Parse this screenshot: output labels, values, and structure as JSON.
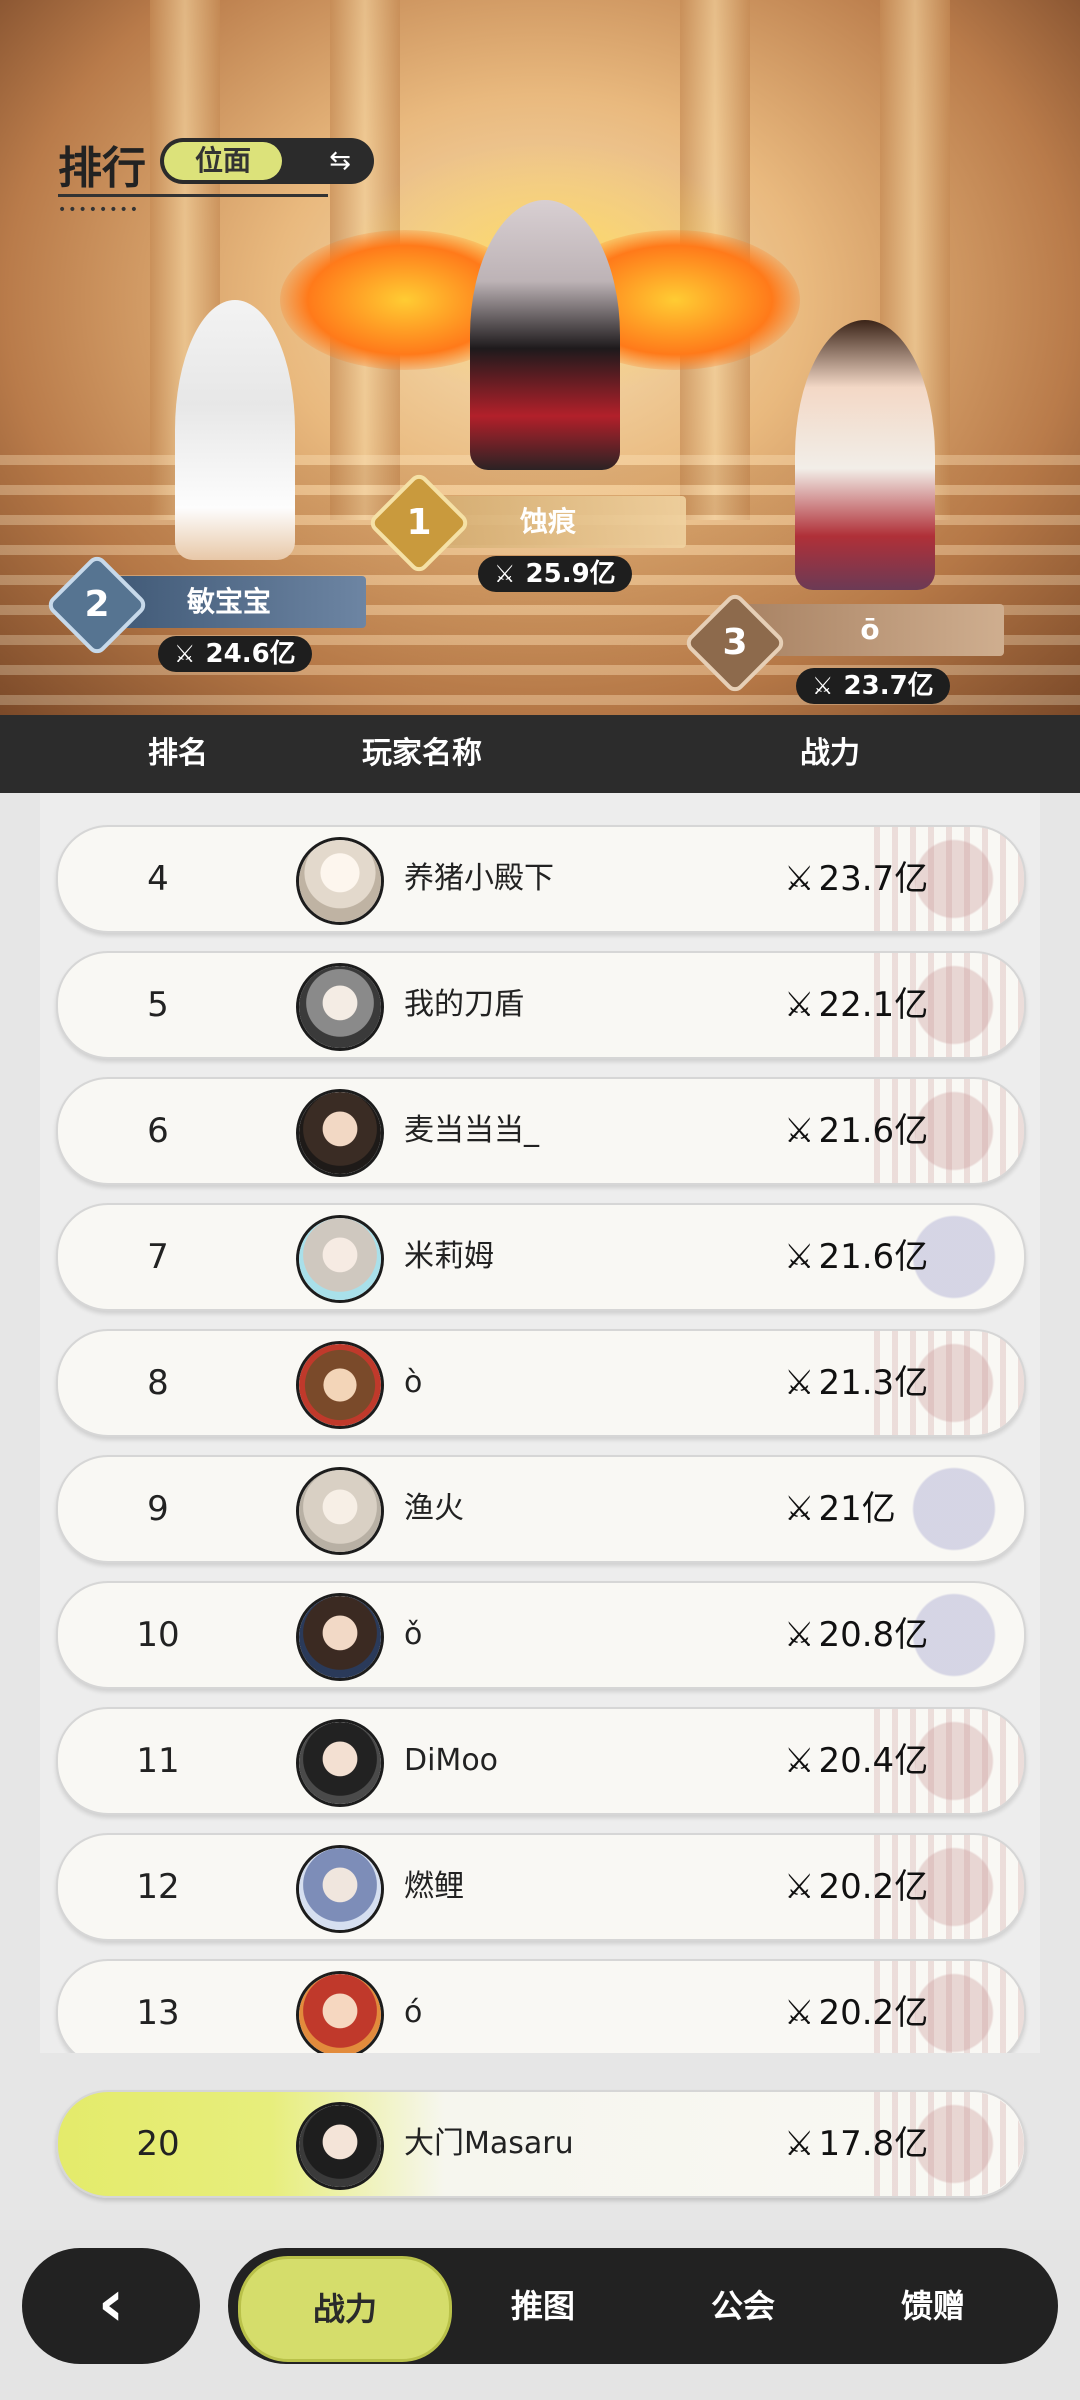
{
  "header": {
    "title": "排行",
    "scope_label": "位面",
    "switch_icon": "swap-arrows-icon"
  },
  "podium": [
    {
      "rank": "1",
      "name": "蚀痕",
      "power": "25.9亿"
    },
    {
      "rank": "2",
      "name": "敏宝宝",
      "power": "24.6亿"
    },
    {
      "rank": "3",
      "name": "ō",
      "power": "23.7亿"
    }
  ],
  "columns": {
    "rank": "排名",
    "name": "玩家名称",
    "power": "战力"
  },
  "power_icon": "crossed-swords-icon",
  "rows": [
    {
      "rank": "4",
      "name": "养猪小殿下",
      "power": "23.7亿"
    },
    {
      "rank": "5",
      "name": "我的刀盾",
      "power": "22.1亿"
    },
    {
      "rank": "6",
      "name": "麦当当当_",
      "power": "21.6亿"
    },
    {
      "rank": "7",
      "name": "米莉姆",
      "power": "21.6亿"
    },
    {
      "rank": "8",
      "name": "ò",
      "power": "21.3亿"
    },
    {
      "rank": "9",
      "name": "渔火",
      "power": "21亿"
    },
    {
      "rank": "10",
      "name": "ǒ",
      "power": "20.8亿"
    },
    {
      "rank": "11",
      "name": "DiMoo",
      "power": "20.4亿"
    },
    {
      "rank": "12",
      "name": "燃鲤",
      "power": "20.2亿"
    },
    {
      "rank": "13",
      "name": "ó",
      "power": "20.2亿"
    }
  ],
  "self_row": {
    "rank": "20",
    "name": "大门Masaru",
    "power": "17.8亿"
  },
  "nav": {
    "back_icon": "chevron-left-icon",
    "tabs": [
      "战力",
      "推图",
      "公会",
      "馈赠"
    ],
    "active_tab": "战力"
  },
  "colors": {
    "accent": "#d5dd6b",
    "dark": "#222222"
  }
}
